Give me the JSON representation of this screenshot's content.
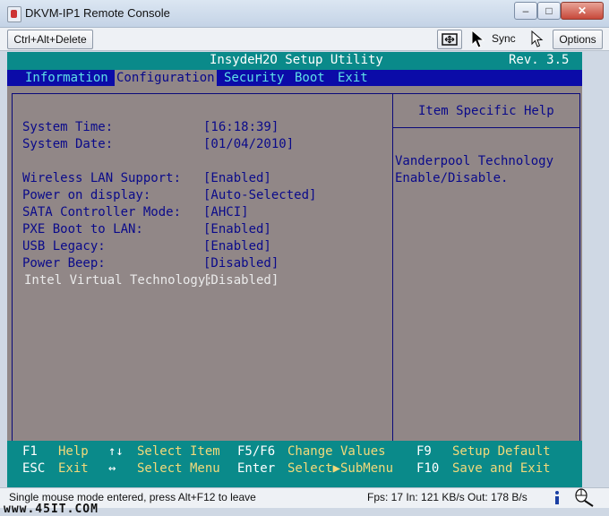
{
  "window": {
    "title": "DKVM-IP1 Remote Console",
    "minimize": "–",
    "maximize": "□",
    "close": "✕"
  },
  "toolbar": {
    "ctrl_alt_delete": "Ctrl+Alt+Delete",
    "sync": "Sync",
    "options": "Options"
  },
  "bios": {
    "title": "InsydeH2O Setup Utility",
    "revision": "Rev. 3.5",
    "menu": [
      "Information",
      "Configuration",
      "Security",
      "Boot",
      "Exit"
    ],
    "active_menu": "Configuration",
    "settings": [
      {
        "label": "System Time:",
        "value": "[16:18:39]"
      },
      {
        "label": "System Date:",
        "value": "[01/04/2010]"
      },
      {
        "label": "Wireless LAN Support:",
        "value": "[Enabled]"
      },
      {
        "label": "Power on display:",
        "value": "[Auto-Selected]"
      },
      {
        "label": "SATA Controller Mode:",
        "value": "[AHCI]"
      },
      {
        "label": "PXE Boot to LAN:",
        "value": "[Enabled]"
      },
      {
        "label": "USB Legacy:",
        "value": "[Enabled]"
      },
      {
        "label": "Power Beep:",
        "value": "[Disabled]"
      },
      {
        "label": "Intel Virtual Technology:",
        "value": "[Disabled]"
      }
    ],
    "help_title": "Item Specific Help",
    "help_lines": [
      "Vanderpool Technology",
      "Enable/Disable."
    ],
    "footer": [
      {
        "key": "F1",
        "desc": "Help"
      },
      {
        "key": "↑↓",
        "desc": "Select Item"
      },
      {
        "key": "F5/F6",
        "desc": "Change Values"
      },
      {
        "key": "F9",
        "desc": "Setup Default"
      },
      {
        "key": "ESC",
        "desc": "Exit"
      },
      {
        "key": "↔",
        "desc": "Select Menu"
      },
      {
        "key": "Enter",
        "desc": "Select▶SubMenu"
      },
      {
        "key": "F10",
        "desc": "Save and Exit"
      }
    ]
  },
  "status": {
    "message": "Single mouse mode entered, press Alt+F12 to leave",
    "stats": "Fps: 17 In: 121 KB/s Out: 178 B/s"
  },
  "watermark": "www.45IT.COM"
}
